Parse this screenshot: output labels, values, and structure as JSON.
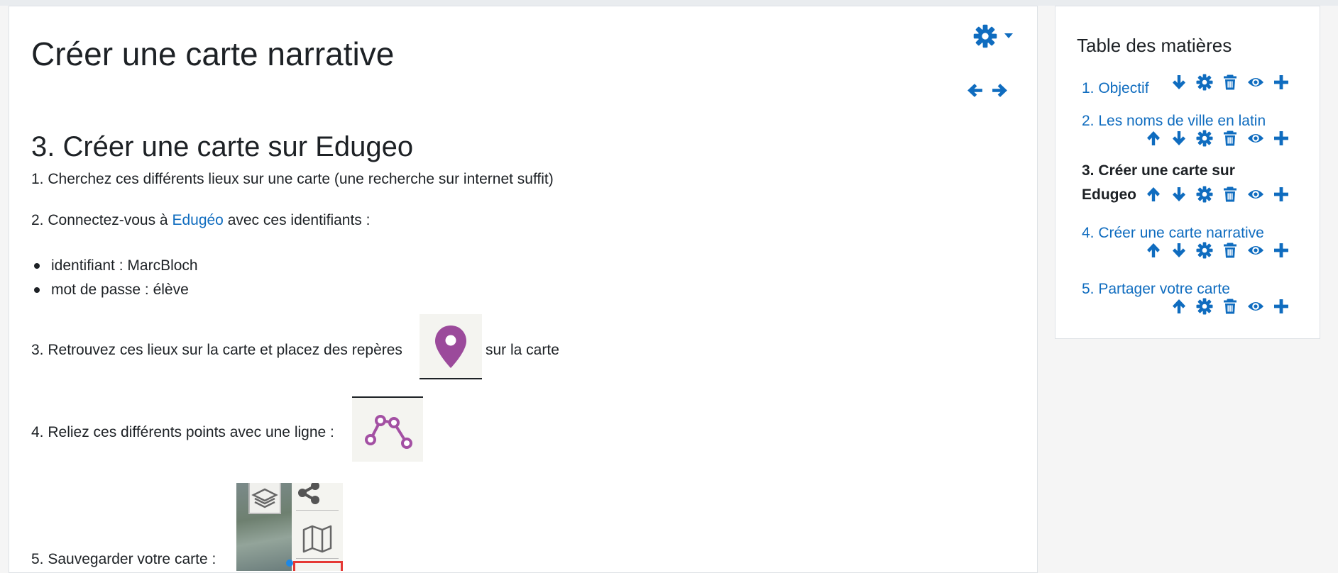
{
  "page": {
    "title": "Créer une carte narrative",
    "chapter_title": "3. Créer une carte sur Edugeo"
  },
  "content": {
    "step1": "1. Cherchez ces différents lieux sur une carte (une recherche sur internet suffit)",
    "step2_prefix": "2. Connectez-vous à ",
    "step2_link": "Edugéo",
    "step2_suffix": " avec ces identifiants :",
    "bullets": [
      "identifiant : MarcBloch",
      "mot de passe : élève"
    ],
    "step3_prefix": "3. Retrouvez ces lieux sur la carte et placez des repères",
    "step3_suffix": "sur la carte",
    "step4": "4. Reliez ces différents points avec une ligne :",
    "step5": "5. Sauvegarder votre carte :"
  },
  "toc": {
    "title": "Table des matières",
    "items": [
      {
        "label": "1. Objectif"
      },
      {
        "label": "2. Les noms de ville en latin"
      },
      {
        "label_line1": "3. Créer une carte sur",
        "label_line2": "Edugeo"
      },
      {
        "label": "4. Créer une carte narrative"
      },
      {
        "label": "5. Partager votre carte"
      }
    ]
  },
  "colors": {
    "link": "#0f6cbf",
    "marker": "#9b4a9b"
  },
  "icons": [
    "gear-icon",
    "caret-down-icon",
    "arrow-left-icon",
    "arrow-right-icon",
    "arrow-up-icon",
    "arrow-down-icon",
    "trash-icon",
    "eye-icon",
    "plus-icon",
    "map-pin-icon",
    "polyline-icon",
    "layers-icon",
    "share-icon",
    "map-icon"
  ]
}
